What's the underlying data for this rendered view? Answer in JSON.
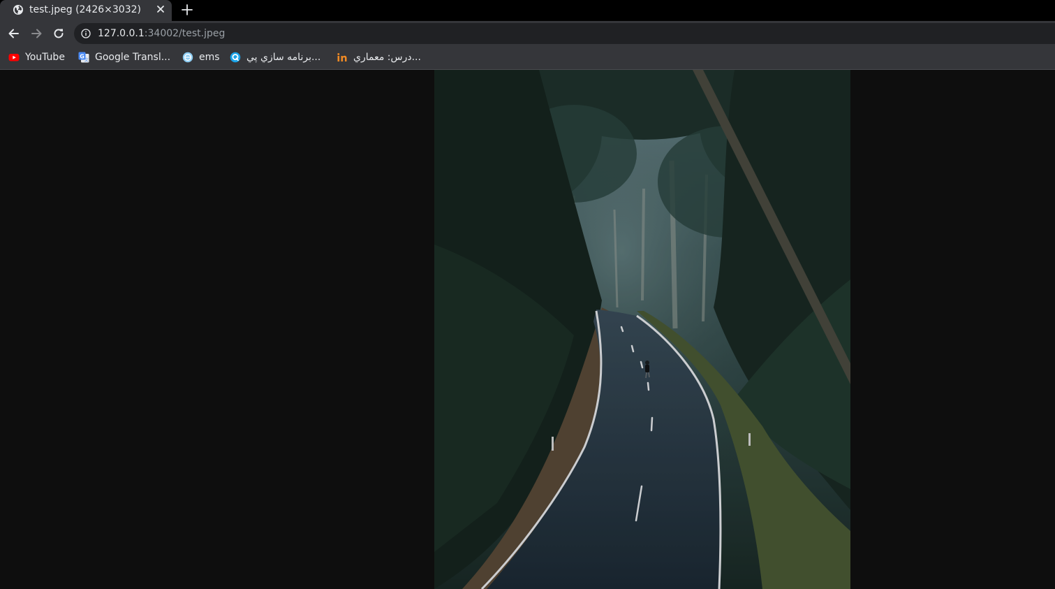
{
  "tab": {
    "title": "test.jpeg (2426×3032)",
    "favicon": "globe-icon"
  },
  "toolbar": {
    "url_host": "127.0.0.1",
    "url_rest": ":34002/test.jpeg"
  },
  "bookmarks": [
    {
      "label": "YouTube",
      "icon": "youtube-icon"
    },
    {
      "label": "Google Transl...",
      "icon": "google-translate-icon"
    },
    {
      "label": "ems",
      "icon": "ems-icon"
    },
    {
      "label": "برنامه سازي پي...",
      "icon": "q-icon"
    },
    {
      "label": "درس: معماري...",
      "icon": "in-icon"
    }
  ],
  "viewer": {
    "image_caption": "test.jpeg",
    "image_width": 2426,
    "image_height": 3032
  },
  "colors": {
    "tab_active": "#35363a",
    "tabstrip": "#000000",
    "omnibox": "#202124",
    "viewer_bg": "#0e0e0e"
  }
}
